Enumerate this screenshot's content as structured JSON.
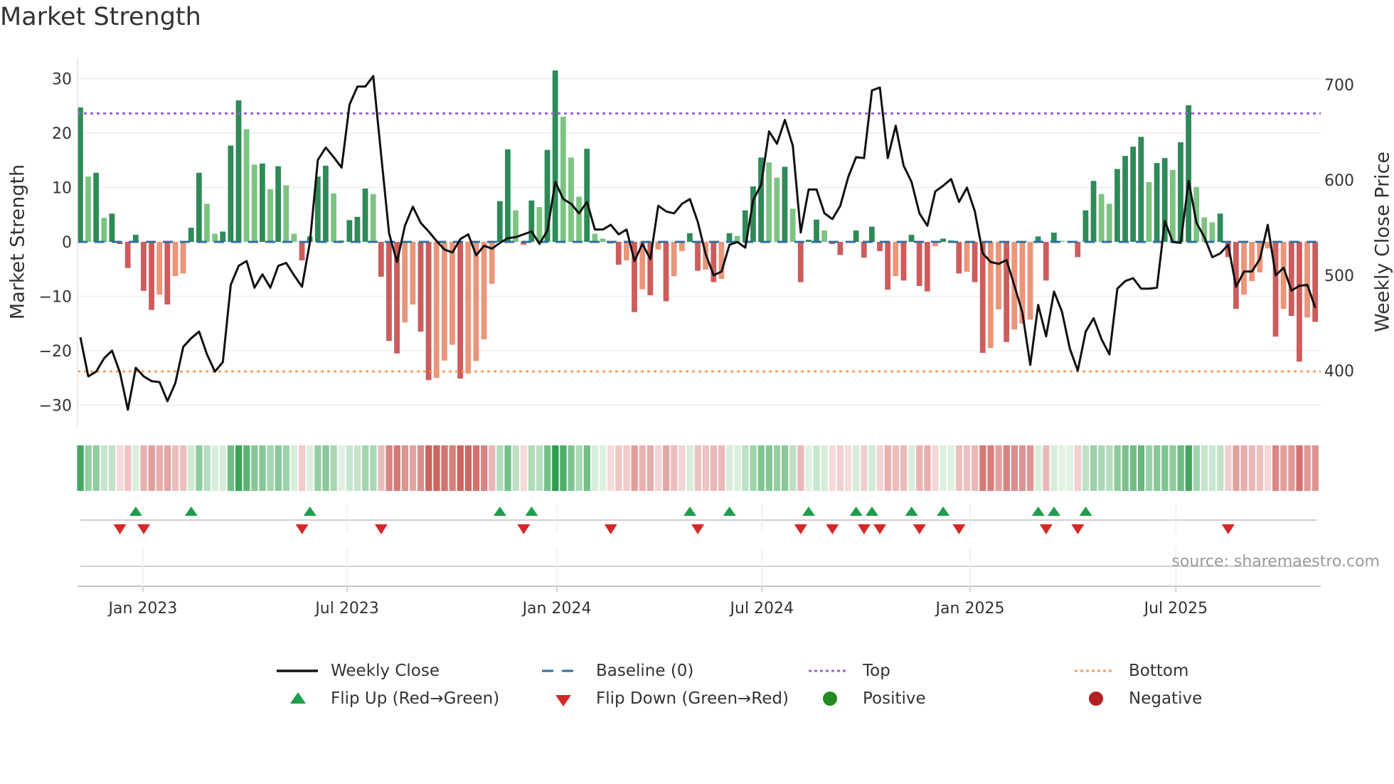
{
  "title": "Market Strength",
  "source": "source: sharemaestro.com",
  "legend": {
    "weekly_close": "Weekly Close",
    "baseline": "Baseline (0)",
    "top": "Top",
    "bottom": "Bottom",
    "flip_up": "Flip Up (Red→Green)",
    "flip_down": "Flip Down (Green→Red)",
    "positive": "Positive",
    "negative": "Negative"
  },
  "colors": {
    "strong_up": "#2e8b57",
    "weak_up": "#7dc383",
    "strong_down": "#cd5c5c",
    "weak_down": "#e9967a",
    "top": "#9b5fd6",
    "bottom": "#f0a060",
    "baseline": "#2f6f9f",
    "flip_up": "#1e9e4a",
    "flip_down": "#d62728",
    "positive": "#228b22",
    "negative": "#b22222",
    "price": "#111111"
  },
  "chart_data": {
    "type": "bar+line",
    "title": "Market Strength",
    "ylabel": "Market Strength",
    "y2label": "Weekly Close Price",
    "ylim": [
      -37,
      34
    ],
    "y2lim": [
      354.5,
      716
    ],
    "yticks": [
      "30",
      "20",
      "10",
      "0",
      "−10",
      "−20",
      "−30"
    ],
    "ytick_values": [
      30,
      20,
      10,
      0,
      -10,
      -20,
      -30
    ],
    "y2ticks": [
      "700",
      "600",
      "500",
      "400"
    ],
    "y2tick_values": [
      700,
      600,
      500,
      400
    ],
    "top_level": 23.6,
    "bottom_level": -23.8,
    "baseline": 0,
    "x_ticks": [
      {
        "label": "Jan 2023",
        "week_index": 7.9
      },
      {
        "label": "Jul 2023",
        "week_index": 33.7
      },
      {
        "label": "Jan 2024",
        "week_index": 60.2
      },
      {
        "label": "Jul 2024",
        "week_index": 86.1
      },
      {
        "label": "Jan 2025",
        "week_index": 112.4
      },
      {
        "label": "Jul 2025",
        "week_index": 138.4
      }
    ],
    "strength": [
      24.7,
      12,
      12.7,
      4.4,
      5.2,
      -0.4,
      -4.8,
      1.3,
      -9,
      -12.5,
      -9.7,
      -11.5,
      -6.3,
      -5.8,
      2.6,
      12.7,
      7,
      1.5,
      1.9,
      17.7,
      26,
      20.7,
      14.2,
      14.4,
      9.7,
      13.9,
      10.4,
      1.5,
      -3.4,
      1,
      12,
      14,
      8.9,
      0.3,
      4,
      4.6,
      9.8,
      8.8,
      -6.4,
      -18.2,
      -20.5,
      -14.8,
      -11.5,
      -16.5,
      -25.4,
      -25,
      -21.8,
      -18.9,
      -25.1,
      -24.2,
      -21.9,
      -17.9,
      -7.7,
      7.5,
      17,
      5.8,
      -0.5,
      7.6,
      6.4,
      16.9,
      31.5,
      23,
      15.5,
      8.3,
      17.1,
      1.5,
      0.6,
      -0.3,
      -4.2,
      -3.4,
      -12.9,
      -8.7,
      -9.8,
      -1.4,
      -10.9,
      -6.3,
      -1.7,
      1.6,
      -5.3,
      -5.1,
      -7.4,
      -6.8,
      1.6,
      1.1,
      5.8,
      10.2,
      15.5,
      14.6,
      11.8,
      13.8,
      6.1,
      -7.4,
      0.4,
      4.1,
      2.1,
      -0.4,
      -2.4,
      -0.2,
      2.1,
      -2.9,
      2.8,
      -1.7,
      -8.8,
      -6.3,
      -7.1,
      1.3,
      -8.1,
      -9.1,
      -0.8,
      0.6,
      0.3,
      -5.8,
      -5.5,
      -7.4,
      -20.4,
      -19.5,
      -12.4,
      -18.4,
      -16.1,
      -15,
      -14.3,
      1,
      -7.1,
      1.7,
      0.2,
      0.2,
      -2.8,
      5.8,
      11.2,
      8.8,
      7,
      13.4,
      15.8,
      17.5,
      19.3,
      11,
      14.5,
      15.4,
      13.2,
      18.3,
      25.1,
      10.1,
      4.5,
      3.6,
      5.2,
      -2.8,
      -12.3,
      -9.7,
      -7.2,
      -5.6,
      -1.2,
      -17.4,
      -12.3,
      -13.6,
      -22,
      -13.9,
      -14.7
    ],
    "weekly_close": [
      435,
      394,
      399,
      413,
      421,
      398,
      359,
      403,
      394,
      389,
      388,
      368,
      387,
      425,
      434,
      441,
      417,
      399,
      409,
      490,
      510,
      515,
      487,
      501,
      487,
      510,
      513,
      500,
      488,
      535,
      621,
      634,
      624,
      613,
      679,
      698,
      698,
      709,
      626,
      544,
      514,
      552,
      572,
      555,
      546,
      536,
      527,
      524,
      538,
      543,
      521,
      531,
      528,
      534,
      539,
      540,
      543,
      546,
      533,
      547,
      598,
      580,
      575,
      565,
      577,
      548,
      548,
      553,
      543,
      548,
      515,
      533,
      517,
      573,
      567,
      565,
      575,
      580,
      556,
      522,
      500,
      504,
      532,
      535,
      529,
      579,
      595,
      651,
      638,
      663,
      636,
      545,
      590,
      590,
      565,
      559,
      573,
      603,
      624,
      623,
      694,
      697,
      623,
      657,
      615,
      598,
      565,
      552,
      588,
      594,
      601,
      577,
      592,
      567,
      523,
      514,
      512,
      516,
      489,
      461,
      406,
      469,
      436,
      483,
      462,
      423,
      400,
      441,
      455,
      433,
      417,
      486,
      494,
      497,
      486,
      486,
      487,
      557,
      535,
      534,
      599,
      555,
      540,
      519,
      523,
      532,
      488,
      504,
      504,
      517,
      553,
      500,
      508,
      484,
      489,
      490,
      466
    ]
  }
}
